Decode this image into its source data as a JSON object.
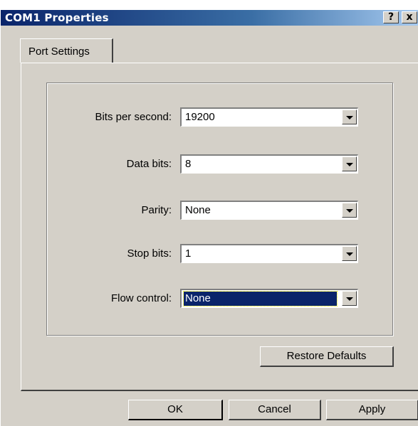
{
  "window": {
    "title": "COM1 Properties",
    "help_button": "?",
    "close_button": "x"
  },
  "tabs": [
    {
      "label": "Port Settings",
      "active": true
    }
  ],
  "settings": {
    "bits_per_second": {
      "label": "Bits per second:",
      "value": "19200"
    },
    "data_bits": {
      "label": "Data bits:",
      "value": "8"
    },
    "parity": {
      "label": "Parity:",
      "value": "None"
    },
    "stop_bits": {
      "label": "Stop bits:",
      "value": "1"
    },
    "flow_control": {
      "label": "Flow control:",
      "value": "None",
      "focused": true
    }
  },
  "buttons": {
    "restore_defaults": "Restore Defaults",
    "ok": "OK",
    "cancel": "Cancel",
    "apply": "Apply"
  },
  "colors": {
    "face": "#d4d0c8",
    "title_start": "#0a246a",
    "title_end": "#a6caf0",
    "selection": "#0a246a"
  }
}
